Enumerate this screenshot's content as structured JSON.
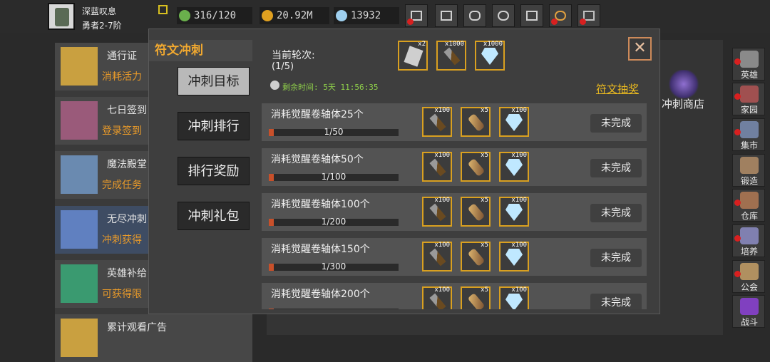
{
  "player": {
    "name": "深蓝叹息",
    "level": "勇者2-7阶"
  },
  "stats": [
    {
      "icon": "energy-icon",
      "value": "316/120",
      "color": "#6ab04c"
    },
    {
      "icon": "gold-coin-icon",
      "value": "20.92M",
      "color": "#e0a020"
    },
    {
      "icon": "gem-icon",
      "value": "13932",
      "color": "#9fd0ef"
    }
  ],
  "top_buttons": [
    {
      "name": "shop-cart-button",
      "alert": true
    },
    {
      "name": "mail-button",
      "alert": false
    },
    {
      "name": "gamepad-button",
      "alert": false
    },
    {
      "name": "settings-button",
      "alert": false
    },
    {
      "name": "gift-button",
      "alert": false
    },
    {
      "name": "lucky-wheel-button",
      "alert": true
    },
    {
      "name": "fireworks-button",
      "alert": true
    }
  ],
  "left_list": [
    {
      "title": "通行证",
      "sub": "消耗活力",
      "color": "#c9a040"
    },
    {
      "title": "七日签到",
      "sub": "登录签到",
      "color": "#9a5a7a"
    },
    {
      "title": "魔法殿堂",
      "sub": "完成任务",
      "color": "#6a8ab0"
    },
    {
      "title": "无尽冲刺",
      "sub": "冲刺获得",
      "color": "#6080c0"
    },
    {
      "title": "英雄补给",
      "sub": "可获得限",
      "color": "#3a9a70"
    },
    {
      "title": "累计观看广告",
      "sub": "",
      "color": "#c9a040"
    }
  ],
  "shop_label": "冲刺商店",
  "right_nav": [
    {
      "label": "英雄",
      "color": "#8a8a8a",
      "alert": true
    },
    {
      "label": "家园",
      "color": "#a05050",
      "alert": true
    },
    {
      "label": "集市",
      "color": "#7080a0",
      "alert": true
    },
    {
      "label": "锻造",
      "color": "#a08060",
      "alert": false
    },
    {
      "label": "仓库",
      "color": "#a07050",
      "alert": true
    },
    {
      "label": "培养",
      "color": "#8080b0",
      "alert": true
    },
    {
      "label": "公会",
      "color": "#b09060",
      "alert": true
    },
    {
      "label": "战斗",
      "color": "#8040c0",
      "alert": false
    }
  ],
  "modal": {
    "title": "符文冲刺",
    "tabs": [
      "冲刺目标",
      "冲刺排行",
      "排行奖励",
      "冲刺礼包"
    ],
    "active_tab": 0,
    "round_label": "当前轮次:",
    "round_value": "(1/5)",
    "remaining": "剩余时间: 5天 11:56:35",
    "draw_link": "符文抽奖",
    "round_rewards": [
      {
        "item": "scroll",
        "qty": "x2"
      },
      {
        "item": "hammer",
        "qty": "x1000"
      },
      {
        "item": "gem",
        "qty": "x1000"
      }
    ],
    "tasks": [
      {
        "name": "消耗觉醒卷轴体25个",
        "progress": "1/50",
        "fraction": 0.02,
        "status": "未完成",
        "rewards": [
          {
            "item": "hammer",
            "qty": "x100"
          },
          {
            "item": "wood",
            "qty": "x5"
          },
          {
            "item": "gem",
            "qty": "x100"
          }
        ]
      },
      {
        "name": "消耗觉醒卷轴体50个",
        "progress": "1/100",
        "fraction": 0.01,
        "status": "未完成",
        "rewards": [
          {
            "item": "hammer",
            "qty": "x100"
          },
          {
            "item": "wood",
            "qty": "x5"
          },
          {
            "item": "gem",
            "qty": "x100"
          }
        ]
      },
      {
        "name": "消耗觉醒卷轴体100个",
        "progress": "1/200",
        "fraction": 0.005,
        "status": "未完成",
        "rewards": [
          {
            "item": "hammer",
            "qty": "x100"
          },
          {
            "item": "wood",
            "qty": "x5"
          },
          {
            "item": "gem",
            "qty": "x100"
          }
        ]
      },
      {
        "name": "消耗觉醒卷轴体150个",
        "progress": "1/300",
        "fraction": 0.0033,
        "status": "未完成",
        "rewards": [
          {
            "item": "hammer",
            "qty": "x100"
          },
          {
            "item": "wood",
            "qty": "x5"
          },
          {
            "item": "gem",
            "qty": "x100"
          }
        ]
      },
      {
        "name": "消耗觉醒卷轴体200个",
        "progress": "",
        "fraction": 0.0025,
        "status": "未完成",
        "rewards": [
          {
            "item": "hammer",
            "qty": "x100"
          },
          {
            "item": "wood",
            "qty": "x5"
          },
          {
            "item": "gem",
            "qty": "x100"
          }
        ]
      }
    ]
  }
}
